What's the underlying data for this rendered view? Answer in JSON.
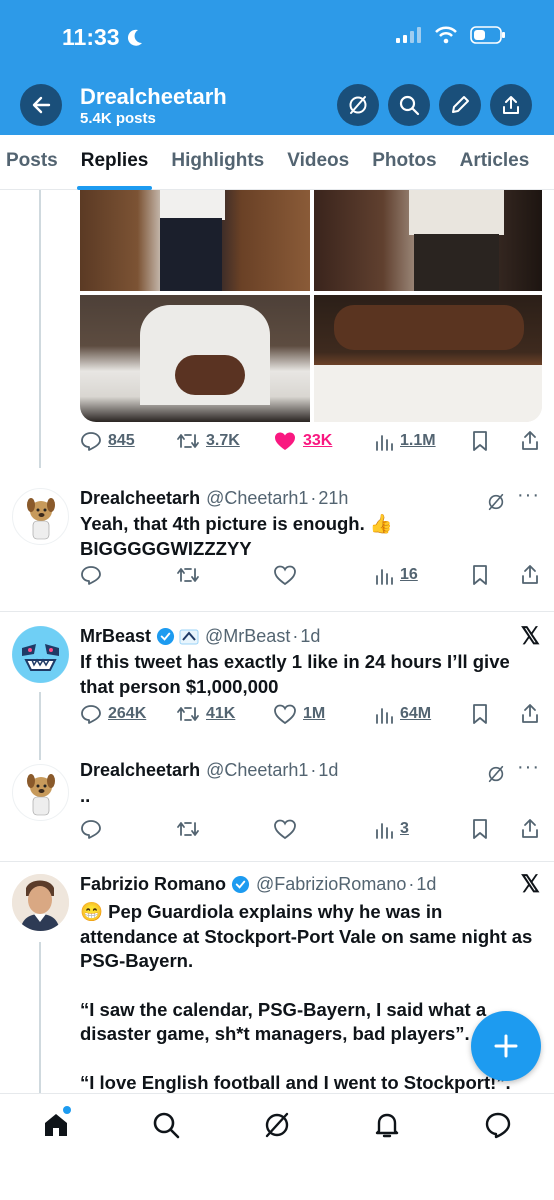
{
  "status": {
    "time": "11:33"
  },
  "profile": {
    "name": "Drealcheetarh",
    "posts": "5.4K posts"
  },
  "tabs": [
    "Posts",
    "Replies",
    "Highlights",
    "Videos",
    "Photos",
    "Articles"
  ],
  "active_tab": "Replies",
  "tweets": [
    {
      "stats": {
        "replies": "845",
        "retweets": "3.7K",
        "likes": "33K",
        "views": "1.1M"
      }
    },
    {
      "name": "Drealcheetarh",
      "handle": "@Cheetarh1",
      "time": "21h",
      "text1": "Yeah, that 4th picture is enough. 👍",
      "text2": "BIGGGGGWIZZZYY",
      "stats": {
        "views": "16"
      }
    },
    {
      "name": "MrBeast",
      "handle": "@MrBeast",
      "time": "1d",
      "text": "If this tweet has exactly 1 like in 24 hours I’ll give that person $1,000,000",
      "stats": {
        "replies": "264K",
        "retweets": "41K",
        "likes": "1M",
        "views": "64M"
      }
    },
    {
      "name": "Drealcheetarh",
      "handle": "@Cheetarh1",
      "time": "1d",
      "text": "..",
      "stats": {
        "views": "3"
      }
    },
    {
      "name": "Fabrizio Romano",
      "handle": "@FabrizioRomano",
      "time": "1d",
      "lines": [
        "😁 Pep Guardiola explains why he was in attendance at Stockport-Port Vale on same night as PSG-Bayern.",
        "“I saw the calendar, PSG-Bayern, I said what a disaster game, sh*t managers, bad players”.",
        "“I love English football and I went to Stockport!”."
      ]
    }
  ],
  "colors": {
    "header": "#2d9ae8",
    "accent": "#1d9bf0",
    "like": "#f91880",
    "muted": "#536471"
  },
  "icons": [
    "back-arrow-icon",
    "grok-icon",
    "search-icon",
    "pencil-icon",
    "share-icon",
    "home-icon",
    "bell-icon",
    "mail-icon",
    "verified-icon",
    "x-logo-icon",
    "plus-icon"
  ]
}
